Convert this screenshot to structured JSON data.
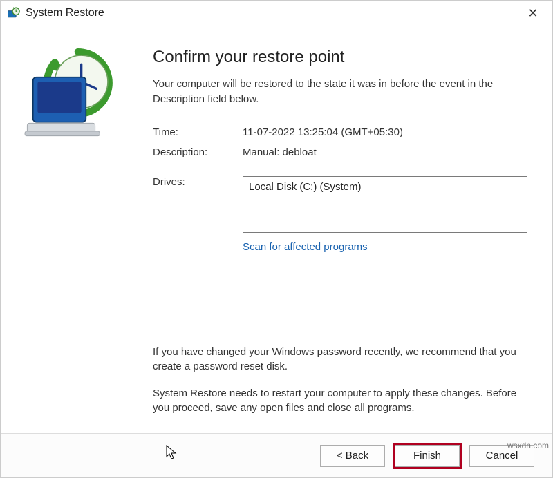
{
  "title": "System Restore",
  "heading": "Confirm your restore point",
  "subtext": "Your computer will be restored to the state it was in before the event in the Description field below.",
  "fields": {
    "time_label": "Time:",
    "time_value": "11-07-2022 13:25:04 (GMT+05:30)",
    "desc_label": "Description:",
    "desc_value": "Manual: debloat",
    "drives_label": "Drives:",
    "drives_value": "Local Disk (C:) (System)"
  },
  "scan_link": "Scan for affected programs",
  "notice_password": "If you have changed your Windows password recently, we recommend that you create a password reset disk.",
  "notice_restart": "System Restore needs to restart your computer to apply these changes. Before you proceed, save any open files and close all programs.",
  "buttons": {
    "back": "< Back",
    "finish": "Finish",
    "cancel": "Cancel"
  },
  "watermark": "wsxdn.com"
}
